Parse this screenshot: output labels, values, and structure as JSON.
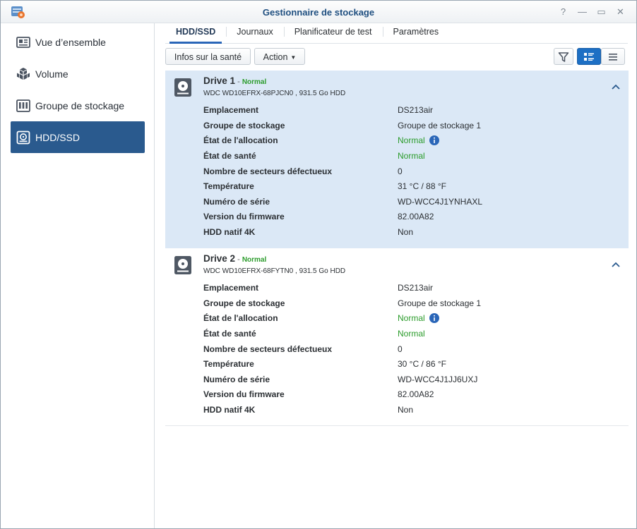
{
  "window": {
    "title": "Gestionnaire de stockage",
    "controls": [
      {
        "name": "help-icon",
        "glyph": "?"
      },
      {
        "name": "minimize-icon",
        "glyph": "—"
      },
      {
        "name": "maximize-icon",
        "glyph": "▭"
      },
      {
        "name": "close-icon",
        "glyph": "✕"
      }
    ]
  },
  "sidebar": {
    "items": [
      {
        "label": "Vue d’ensemble",
        "icon": "overview-icon",
        "active": false
      },
      {
        "label": "Volume",
        "icon": "volume-cubes-icon",
        "active": false
      },
      {
        "label": "Groupe de stockage",
        "icon": "storage-pool-icon",
        "active": false
      },
      {
        "label": "HDD/SSD",
        "icon": "hdd-icon",
        "active": true
      }
    ]
  },
  "tabs": [
    {
      "label": "HDD/SSD",
      "active": true
    },
    {
      "label": "Journaux",
      "active": false
    },
    {
      "label": "Planificateur de test",
      "active": false
    },
    {
      "label": "Paramètres",
      "active": false
    }
  ],
  "toolbar": {
    "health_label": "Infos sur la santé",
    "action_label": "Action",
    "filter_icon": "filter-icon",
    "list_view_icon": "detail-list-icon",
    "compact_view_icon": "compact-list-icon"
  },
  "colors": {
    "accent": "#2a5a8e",
    "status_green": "#2c9c2c",
    "selected_row": "#dbe8f6"
  },
  "property_labels": [
    "Emplacement",
    "Groupe de stockage",
    "État de l'allocation",
    "État de santé",
    "Nombre de secteurs défectueux",
    "Température",
    "Numéro de série",
    "Version du firmware",
    "HDD natif 4K"
  ],
  "drives": [
    {
      "name": "Drive 1",
      "separator": " - ",
      "status": "Normal",
      "model": "WDC WD10EFRX-68PJCN0 , 931.5 Go HDD",
      "selected": true,
      "values": [
        "DS213air",
        "Groupe de stockage 1",
        "Normal",
        "Normal",
        "0",
        "31 °C / 88 °F",
        "WD-WCC4J1YNHAXL",
        "82.00A82",
        "Non"
      ]
    },
    {
      "name": "Drive 2",
      "separator": " - ",
      "status": "Normal",
      "model": "WDC WD10EFRX-68FYTN0 , 931.5 Go HDD",
      "selected": false,
      "values": [
        "DS213air",
        "Groupe de stockage 1",
        "Normal",
        "Normal",
        "0",
        "30 °C / 86 °F",
        "WD-WCC4J1JJ6UXJ",
        "82.00A82",
        "Non"
      ]
    }
  ]
}
